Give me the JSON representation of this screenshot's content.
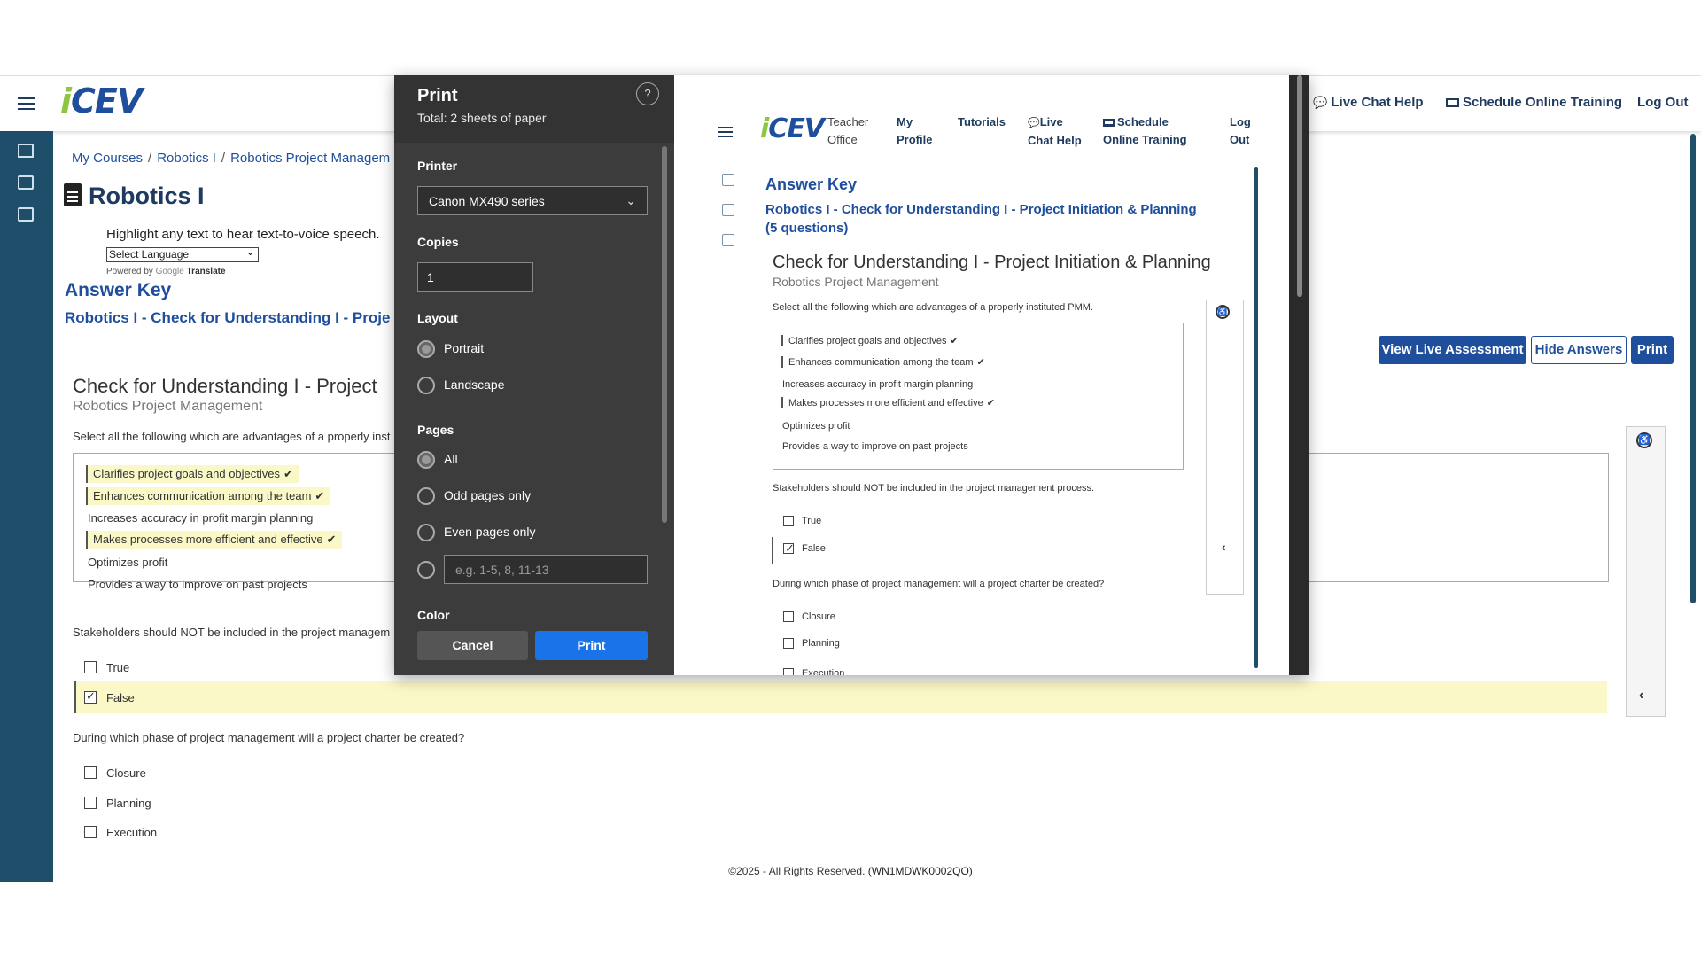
{
  "app": {
    "logo_text": "CEV",
    "logo_i": "i",
    "top_links": {
      "live_chat": "Live Chat Help",
      "schedule": "Schedule Online Training",
      "logout": "Log Out"
    }
  },
  "breadcrumb": [
    "My Courses",
    "/",
    "Robotics I",
    "/",
    "Robotics Project Managem"
  ],
  "page_title": "Robotics I",
  "hint": "Highlight any text to hear text-to-voice speech.",
  "language_select": "Select Language",
  "powered_by": "Powered by",
  "google": "Google",
  "translate": "Translate",
  "answer_key": "Answer Key",
  "assessment_link": "Robotics I - Check for Understanding I - Proje",
  "actions": {
    "view_live": "View Live Assessment",
    "hide_answers": "Hide Answers",
    "print": "Print"
  },
  "quiz": {
    "title_clipped": "Check for Understanding I - Project",
    "subtitle": "Robotics Project Management",
    "q1_clipped": "Select all the following which are advantages of a properly inst",
    "q1_options": [
      {
        "text": "Clarifies project goals and objectives",
        "correct": true
      },
      {
        "text": "Enhances communication among the team",
        "correct": true
      },
      {
        "text": "Increases accuracy in profit margin planning",
        "correct": false
      },
      {
        "text": "Makes processes more efficient and effective",
        "correct": true
      },
      {
        "text": "Optimizes profit",
        "correct": false
      },
      {
        "text": "Provides a way to improve on past projects",
        "correct": false
      }
    ],
    "q2_clipped": "Stakeholders should NOT be included in the project managem",
    "q2_options": [
      {
        "text": "True",
        "checked": false
      },
      {
        "text": "False",
        "checked": true
      }
    ],
    "q3": "During which phase of project management will a project charter be created?",
    "q3_options": [
      "Closure",
      "Planning",
      "Execution"
    ]
  },
  "footer": {
    "text": "©2025 - All Rights Reserved.",
    "code": "(WN1MDWK0002QO)"
  },
  "print_dialog": {
    "title": "Print",
    "subtitle": "Total: 2 sheets of paper",
    "help": "?",
    "printer_label": "Printer",
    "printer_value": "Canon MX490 series",
    "copies_label": "Copies",
    "copies_value": "1",
    "layout_label": "Layout",
    "layout_options": [
      "Portrait",
      "Landscape"
    ],
    "layout_selected": "Portrait",
    "pages_label": "Pages",
    "pages_options": [
      "All",
      "Odd pages only",
      "Even pages only"
    ],
    "pages_selected": "All",
    "custom_pages_placeholder": "e.g. 1-5, 8, 11-13",
    "color_label": "Color",
    "cancel": "Cancel",
    "print": "Print"
  },
  "preview": {
    "teacher_office": [
      "Teacher",
      "Office"
    ],
    "my_profile": [
      "My",
      "Profile"
    ],
    "tutorials": "Tutorials",
    "live_chat": [
      "Live",
      "Chat Help"
    ],
    "schedule": [
      "Schedule",
      "Online Training"
    ],
    "logout": [
      "Log",
      "Out"
    ],
    "answer_key": "Answer Key",
    "assessment_title_1": "Robotics I - Check for Understanding I - Project Initiation & Planning",
    "assessment_title_2": "(5 questions)",
    "quiz_title": "Check for Understanding I - Project Initiation & Planning",
    "quiz_subtitle": "Robotics Project Management",
    "q1": "Select all the following which are advantages of a properly instituted PMM.",
    "q2": "Stakeholders should NOT be included in the project management process.",
    "q3": "During which phase of project management will a project charter be created?",
    "q3_options": [
      "Closure",
      "Planning",
      "Execution"
    ]
  },
  "colors": {
    "brand_blue": "#1f4f9c",
    "sidebar": "#1f4e6b",
    "highlight": "#fbf8c8",
    "print_blue": "#1a73e8"
  }
}
